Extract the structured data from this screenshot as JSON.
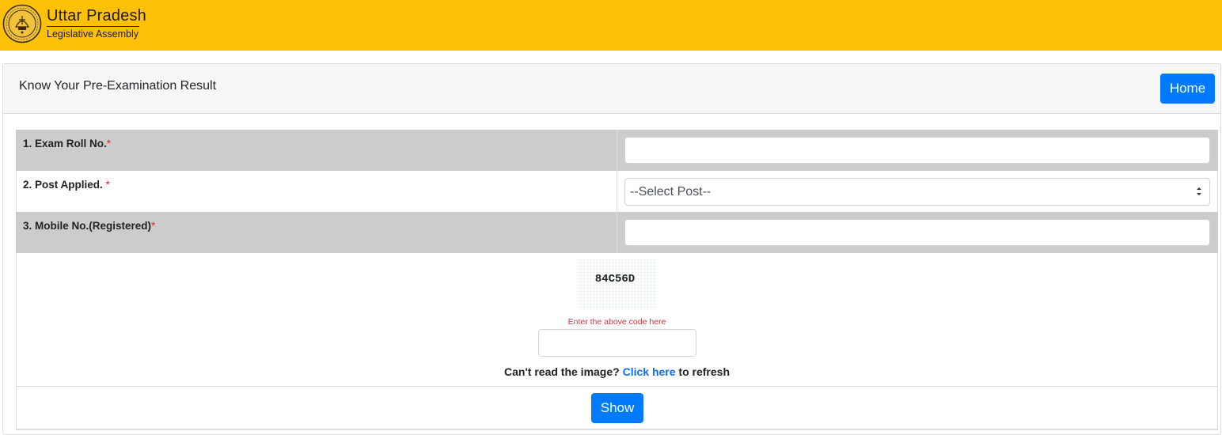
{
  "header": {
    "brand_title": "Uttar Pradesh",
    "brand_subtitle": "Legislative Assembly",
    "logo_icon": "up-assembly-seal-icon",
    "background_color": "#ffc107"
  },
  "card": {
    "title": "Know Your Pre-Examination Result",
    "home_label": "Home"
  },
  "form": {
    "fields": [
      {
        "label": "1. Exam Roll No.",
        "required_mark": "*",
        "value": ""
      },
      {
        "label": "2. Post Applied. ",
        "required_mark": "*",
        "selected": "--Select Post--"
      },
      {
        "label": "3. Mobile No.(Registered)",
        "required_mark": "*",
        "value": ""
      }
    ],
    "captcha": {
      "code": "84C56D",
      "hint": "Enter the above code here",
      "input_value": "",
      "refresh_prefix": "Can't read the image? ",
      "refresh_link": "Click here",
      "refresh_suffix": " to refresh"
    },
    "submit_label": "Show"
  },
  "colors": {
    "primary": "#007bff",
    "required": "#e0242a",
    "link": "#0d6efd",
    "row_gray": "#cccccc"
  }
}
